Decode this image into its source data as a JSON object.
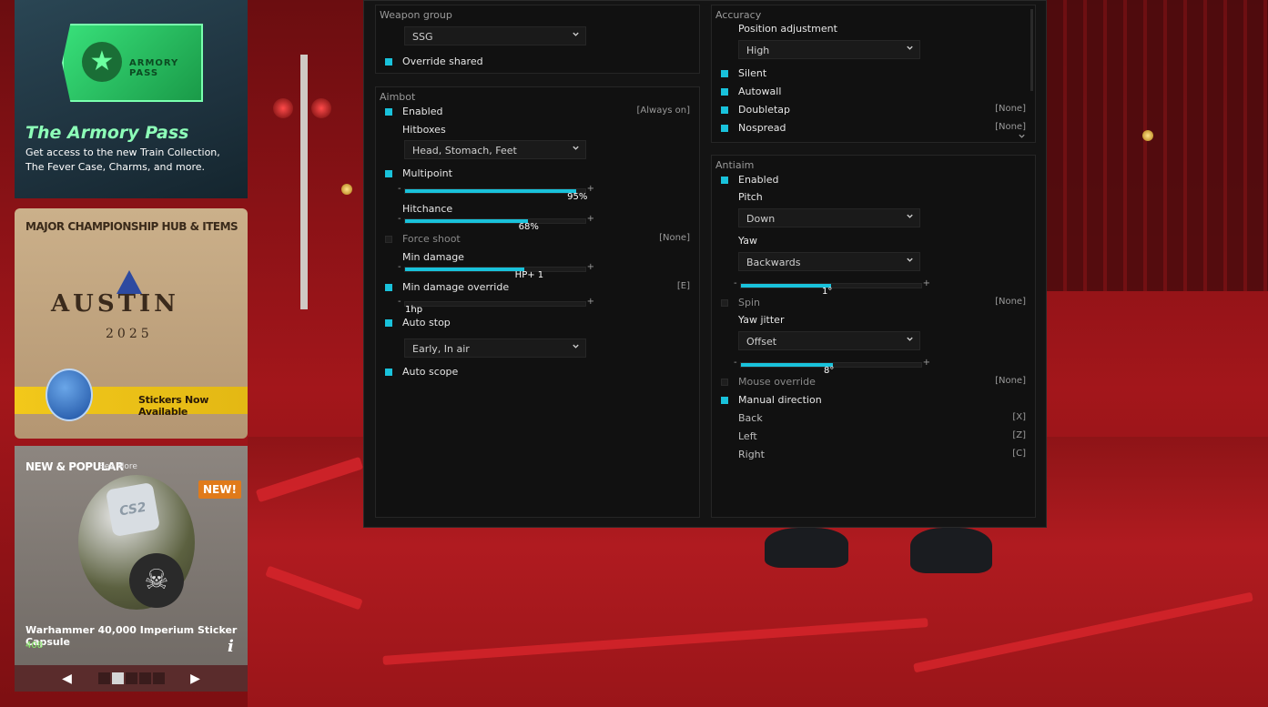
{
  "promos": {
    "armory": {
      "ticket_text": "ARMORY PASS",
      "title": "The Armory Pass",
      "description": "Get access to the new Train Collection, The Fever Case, Charms, and more."
    },
    "major": {
      "title": "MAJOR CHAMPIONSHIP HUB & ITEMS",
      "logo_text": "AUSTIN",
      "year": "2025",
      "banner": "Stickers Now Available"
    },
    "new_popular": {
      "title": "NEW & POPULAR",
      "see_more": "See More",
      "badge": "NEW!",
      "cube_text": "CS2",
      "item_name": "Warhammer 40,000 Imperium Sticker Capsule",
      "price": "408",
      "info": "i",
      "prev": "◀",
      "next": "▶",
      "page_count": 5,
      "active_page": 2
    }
  },
  "menu": {
    "weapon_group": {
      "title": "Weapon group",
      "selected": "SSG",
      "override_shared": {
        "label": "Override shared",
        "checked": true
      }
    },
    "aimbot": {
      "title": "Aimbot",
      "enabled": {
        "label": "Enabled",
        "checked": true,
        "key": "[Always on]"
      },
      "hitboxes": {
        "label": "Hitboxes",
        "value": "Head, Stomach, Feet"
      },
      "multipoint": {
        "label": "Multipoint",
        "checked": true,
        "value": 95,
        "display": "95%"
      },
      "hitchance": {
        "label": "Hitchance",
        "value": 68,
        "display": "68%"
      },
      "force_shoot": {
        "label": "Force shoot",
        "checked": false,
        "key": "[None]"
      },
      "min_damage": {
        "label": "Min damage",
        "value": 66,
        "display": "HP+ 1"
      },
      "min_damage_override": {
        "label": "Min damage override",
        "checked": true,
        "key": "[E]",
        "value": 0,
        "display": "1hp"
      },
      "auto_stop": {
        "label": "Auto stop",
        "checked": true,
        "value": "Early, In air"
      },
      "auto_scope": {
        "label": "Auto scope",
        "checked": true
      }
    },
    "accuracy": {
      "title": "Accuracy",
      "position_adjustment": {
        "label": "Position adjustment",
        "value": "High"
      },
      "silent": {
        "label": "Silent",
        "checked": true
      },
      "autowall": {
        "label": "Autowall",
        "checked": true
      },
      "doubletap": {
        "label": "Doubletap",
        "checked": true,
        "key": "[None]"
      },
      "nospread": {
        "label": "Nospread",
        "checked": true,
        "key": "[None]"
      }
    },
    "antiaim": {
      "title": "Antiaim",
      "enabled": {
        "label": "Enabled",
        "checked": true
      },
      "pitch": {
        "label": "Pitch",
        "value": "Down"
      },
      "yaw": {
        "label": "Yaw",
        "value": "Backwards",
        "slider": 50,
        "display": "1°"
      },
      "spin": {
        "label": "Spin",
        "checked": false,
        "key": "[None]"
      },
      "yaw_jitter": {
        "label": "Yaw jitter",
        "value": "Offset",
        "slider": 51,
        "display": "8°"
      },
      "mouse_override": {
        "label": "Mouse override",
        "checked": false,
        "key": "[None]"
      },
      "manual_direction": {
        "label": "Manual direction",
        "checked": true
      },
      "back": {
        "label": "Back",
        "key": "[X]"
      },
      "left": {
        "label": "Left",
        "key": "[Z]"
      },
      "right": {
        "label": "Right",
        "key": "[C]"
      }
    }
  },
  "colors": {
    "accent": "#19c2db",
    "panel": "#141414",
    "group": "#111111"
  }
}
